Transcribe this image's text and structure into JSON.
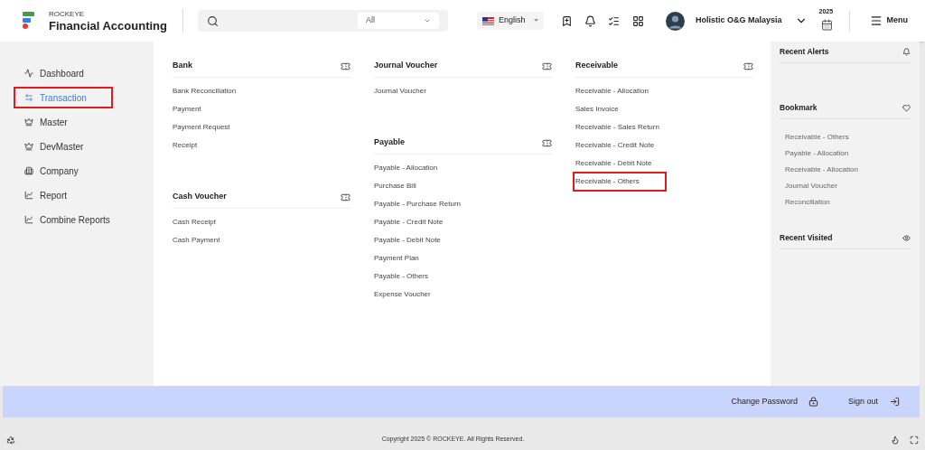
{
  "header": {
    "brand_small": "ROCKEYE",
    "brand_title": "Financial Accounting",
    "search": {
      "scope": "All"
    },
    "language": "English",
    "user": "Holistic O&G Malaysia",
    "year": "2025",
    "menu_label": "Menu"
  },
  "sidebar": {
    "items": [
      {
        "label": "Dashboard",
        "selected": false,
        "highlighted": false
      },
      {
        "label": "Transaction",
        "selected": true,
        "highlighted": true
      },
      {
        "label": "Master",
        "selected": false,
        "highlighted": false
      },
      {
        "label": "DevMaster",
        "selected": false,
        "highlighted": false
      },
      {
        "label": "Company",
        "selected": false,
        "highlighted": false
      },
      {
        "label": "Report",
        "selected": false,
        "highlighted": false
      },
      {
        "label": "Combine Reports",
        "selected": false,
        "highlighted": false
      }
    ]
  },
  "menu_columns": [
    [
      {
        "title": "Bank",
        "items": [
          {
            "label": "Bank Reconciliation",
            "highlighted": false
          },
          {
            "label": "Payment",
            "highlighted": false
          },
          {
            "label": "Payment Request",
            "highlighted": false
          },
          {
            "label": "Receipt",
            "highlighted": false
          }
        ]
      },
      {
        "title": "Cash Voucher",
        "items": [
          {
            "label": "Cash Receipt",
            "highlighted": false
          },
          {
            "label": "Cash Payment",
            "highlighted": false
          }
        ]
      }
    ],
    [
      {
        "title": "Journal Voucher",
        "items": [
          {
            "label": "Journal Voucher",
            "highlighted": false
          }
        ]
      },
      {
        "title": "Payable",
        "items": [
          {
            "label": "Payable - Allocation",
            "highlighted": false
          },
          {
            "label": "Purchase Bill",
            "highlighted": false
          },
          {
            "label": "Payable - Purchase Return",
            "highlighted": false
          },
          {
            "label": "Payable - Credit Note",
            "highlighted": false
          },
          {
            "label": "Payable - Debit Note",
            "highlighted": false
          },
          {
            "label": "Payment Plan",
            "highlighted": false
          },
          {
            "label": "Payable - Others",
            "highlighted": false
          },
          {
            "label": "Expense Voucher",
            "highlighted": false
          }
        ]
      }
    ],
    [
      {
        "title": "Receivable",
        "items": [
          {
            "label": "Receivable - Allocation",
            "highlighted": false
          },
          {
            "label": "Sales Invoice",
            "highlighted": false
          },
          {
            "label": "Receivable - Sales Return",
            "highlighted": false
          },
          {
            "label": "Receivable - Credit Note",
            "highlighted": false
          },
          {
            "label": "Receivable - Debit Note",
            "highlighted": false
          },
          {
            "label": "Receivable - Others",
            "highlighted": true
          }
        ]
      }
    ]
  ],
  "right_panel": {
    "sections": [
      {
        "title": "Recent Alerts"
      },
      {
        "title": "Bookmark",
        "items": [
          "Receivable - Others",
          "Payable - Allocation",
          "Receivable - Allocation",
          "Journal Voucher",
          "Reconciliation"
        ]
      },
      {
        "title": "Recent Visited"
      }
    ]
  },
  "action_bar": {
    "change_password": "Change Password",
    "sign_out": "Sign out"
  },
  "footer": {
    "copyright": "Copyright 2025 © ROCKEYE. All Rights Reserved."
  }
}
